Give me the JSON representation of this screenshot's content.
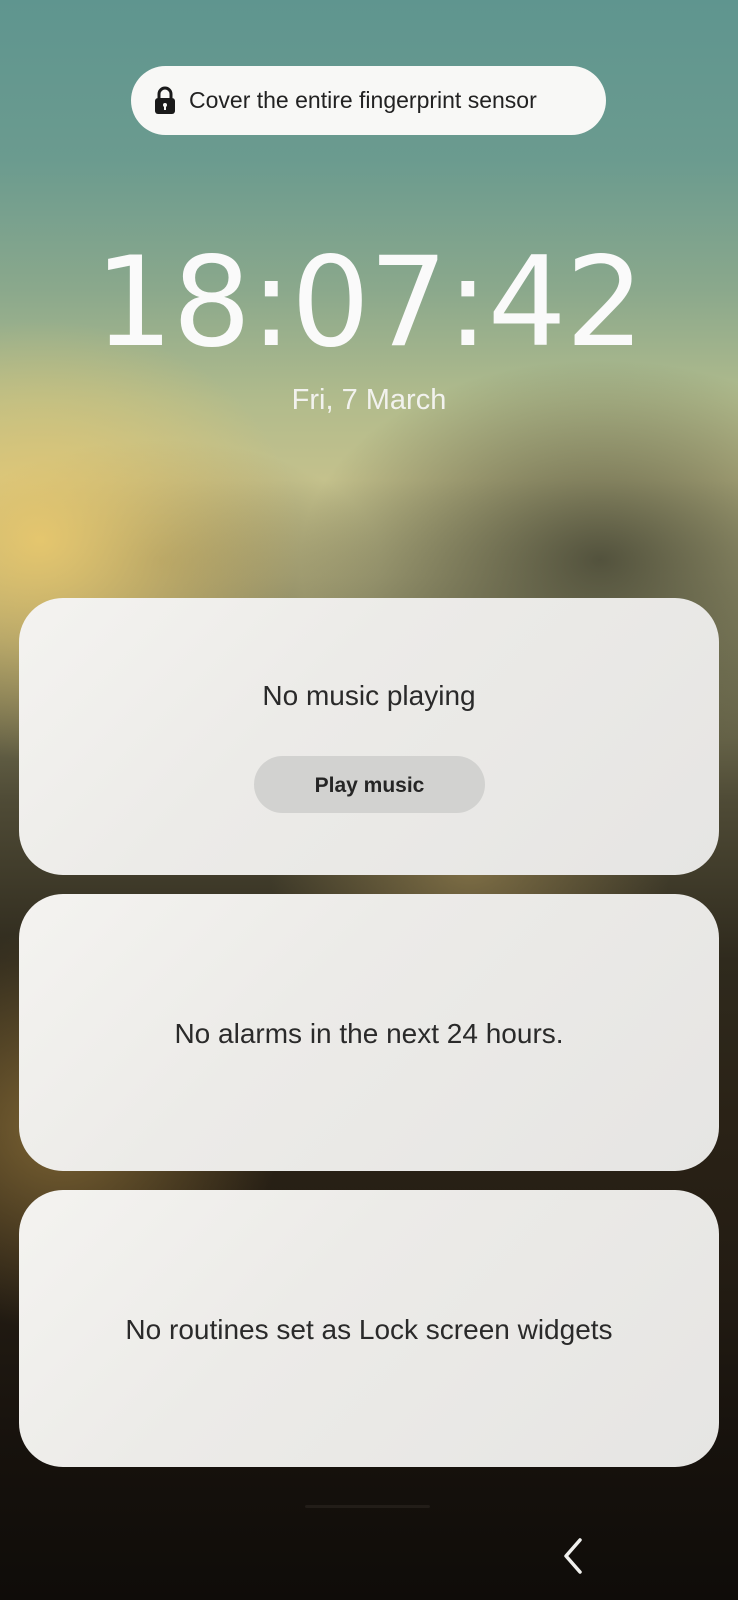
{
  "lock_screen": {
    "fingerprint_hint": "Cover the entire fingerprint sensor",
    "lock_icon": "lock-icon",
    "time": "18:07:42",
    "date": "Fri, 7 March"
  },
  "widgets": {
    "music": {
      "status": "No music playing",
      "button_label": "Play music"
    },
    "alarms": {
      "status": "No alarms in the next 24 hours."
    },
    "routines": {
      "status": "No routines set as Lock screen widgets"
    }
  },
  "navigation": {
    "back_icon": "chevron-left-icon"
  }
}
